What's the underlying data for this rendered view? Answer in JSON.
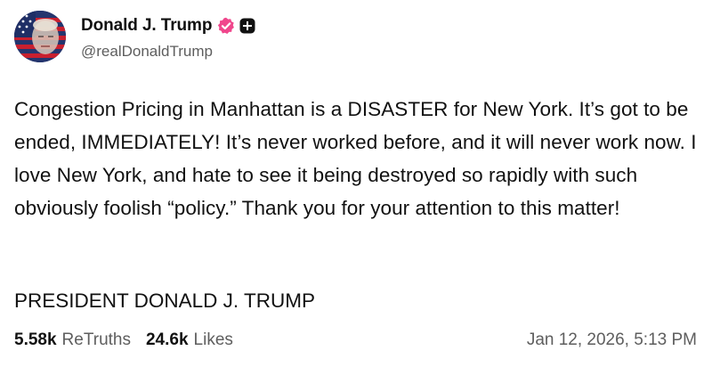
{
  "author": {
    "display_name": "Donald J. Trump",
    "handle": "@realDonaldTrump",
    "avatar_icon": "flag-portrait-avatar",
    "verified_icon": "verified-badge-icon",
    "extra_badge_icon": "plus-badge-icon",
    "verified_color": "#f0468c"
  },
  "post": {
    "text": "Congestion Pricing in Manhattan is a DISASTER for New York. It’s got to be ended, IMMEDIATELY! It’s never worked before, and it will never work now. I love New York, and hate to see it being destroyed so rapidly with such obviously foolish “policy.” Thank you for your attention to this matter!",
    "signature": "PRESIDENT DONALD J. TRUMP"
  },
  "stats": {
    "retruths_count": "5.58k",
    "retruths_label": "ReTruths",
    "likes_count": "24.6k",
    "likes_label": "Likes"
  },
  "timestamp": "Jan 12, 2026, 5:13 PM"
}
